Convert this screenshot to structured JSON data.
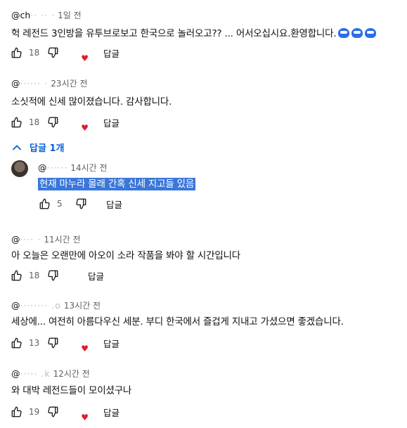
{
  "comments": [
    {
      "author": "@ch",
      "author_masked": "·· ·· ·",
      "time": "1일 전",
      "text": "헉 레전드 3인방을 유투브로보고  한국으로 놀러오고?? ... 어서오십시요.환영합니다.",
      "emoji_count": 3,
      "likes": "18",
      "reply_label": "답글"
    },
    {
      "author": "@",
      "author_masked": "······ ·",
      "time": "23시간 전",
      "text": "소싯적에 신세 많이졌습니다. 감사합니다.",
      "likes": "18",
      "reply_label": "답글"
    },
    {
      "author": "@",
      "author_masked": "···· ·",
      "time": "11시간 전",
      "text": "아 오늘은 오랜만에 아오이 소라 작품을 봐야 할 시간입니다",
      "likes": "18",
      "reply_label": "답글"
    },
    {
      "author": "@",
      "author_masked": "········ .o",
      "time": "13시간 전",
      "text": "세상에... 여전히 아름다우신 세분. 부디 한국에서 즐겁게 지내고 가셨으면 좋겠습니다.",
      "likes": "13",
      "reply_label": "답글"
    },
    {
      "author": "@",
      "author_masked": "····· .k",
      "time": "12시간 전",
      "text": "와  대박  레전드들이 모이셨구나",
      "likes": "19",
      "reply_label": "답글"
    }
  ],
  "replies_toggle": {
    "label": "답글 1개"
  },
  "reply": {
    "author": "@",
    "author_masked": "······",
    "time": "14시간 전",
    "text": "현재 마누라 몰래 간혹 신세 지고들 있음",
    "likes": "5",
    "reply_label": "답글"
  },
  "colors": {
    "link_blue": "#065fd4",
    "highlight": "#3a77d9",
    "heart": "#e21b2f"
  },
  "icons": [
    "thumb-up-icon",
    "thumb-down-icon",
    "creator-heart-icon",
    "chevron-up-icon",
    "emoji-icon"
  ]
}
